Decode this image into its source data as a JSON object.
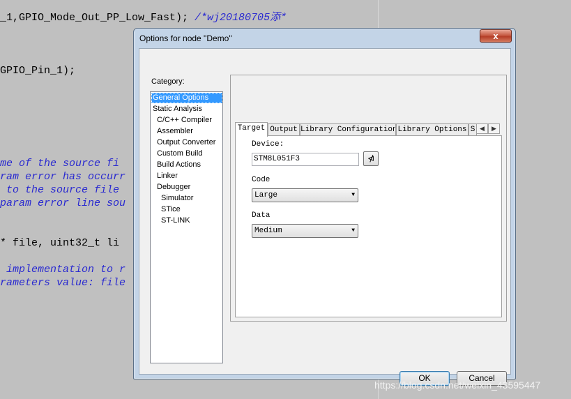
{
  "editor": {
    "lines": [
      {
        "text": "_1,GPIO_Mode_Out_PP_Low_Fast); ",
        "comment": "/*wj20180705添*"
      },
      {
        "text": "GPIO_Pin_1);",
        "comment": ""
      },
      {
        "text": "",
        "comment": "me of the source fi"
      },
      {
        "text": "",
        "comment": "ram error has occurr"
      },
      {
        "text": "",
        "comment": " to the source file "
      },
      {
        "text": "",
        "comment": "param error line sou"
      },
      {
        "text": "* file, uint32_t li",
        "comment": ""
      },
      {
        "text": "",
        "comment": " implementation to r"
      },
      {
        "text": "",
        "comment": "rameters value: file"
      }
    ]
  },
  "watermark": "https://blog.csdn.net/weixin_43595447",
  "dialog": {
    "title": "Options for node \"Demo\"",
    "close_label": "x",
    "category_label": "Category:",
    "categories": [
      {
        "label": "General Options",
        "indent": 0
      },
      {
        "label": "Static Analysis",
        "indent": 0
      },
      {
        "label": "C/C++ Compiler",
        "indent": 1
      },
      {
        "label": "Assembler",
        "indent": 1
      },
      {
        "label": "Output Converter",
        "indent": 1
      },
      {
        "label": "Custom Build",
        "indent": 1
      },
      {
        "label": "Build Actions",
        "indent": 1
      },
      {
        "label": "Linker",
        "indent": 1
      },
      {
        "label": "Debugger",
        "indent": 1
      },
      {
        "label": "Simulator",
        "indent": 2
      },
      {
        "label": "STice",
        "indent": 2
      },
      {
        "label": "ST-LINK",
        "indent": 2
      }
    ],
    "selected_category": "General Options",
    "tabs": [
      "Target",
      "Output",
      "Library Configuration",
      "Library Options",
      "S"
    ],
    "active_tab": "Target",
    "scroll_left": "◀",
    "scroll_right": "▶",
    "device_label": "Device:",
    "device_value": "STM8L051F3",
    "device_browse_icon": "⋪",
    "code_label": "Code",
    "code_value": "Large",
    "data_label": "Data",
    "data_value": "Medium",
    "combo_arrow": "▼",
    "ok_label": "OK",
    "cancel_label": "Cancel"
  }
}
